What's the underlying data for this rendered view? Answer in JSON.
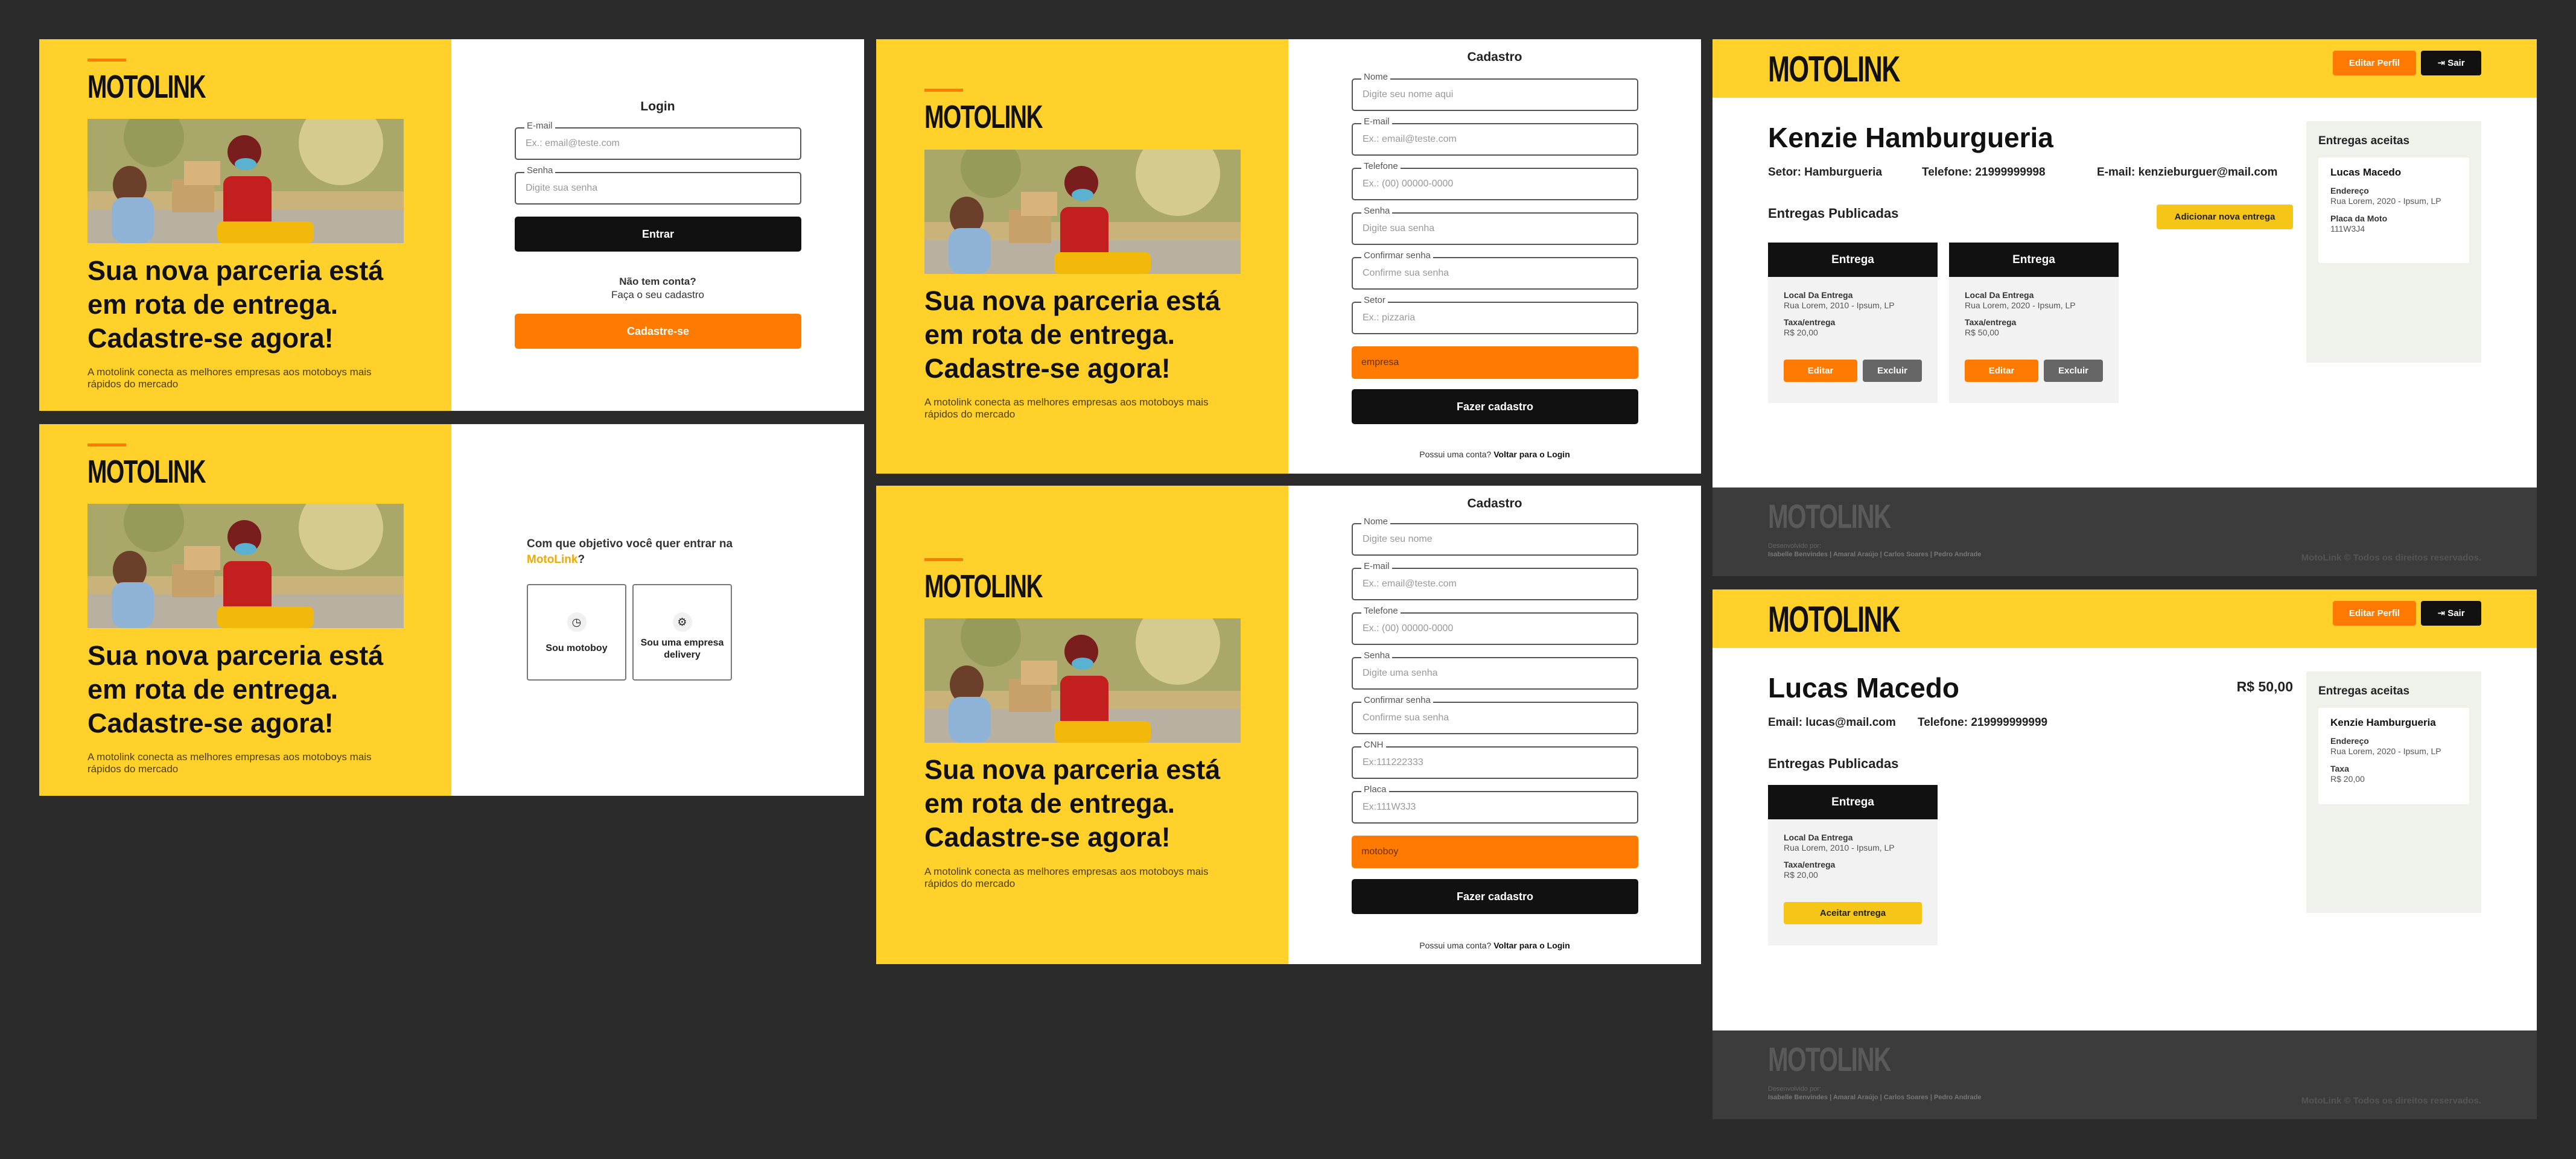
{
  "brand": {
    "logo": "MOTOLINK",
    "headline": "Sua nova parceria está em rota de entrega. Cadastre-se agora!",
    "subtext": "A motolink conecta as melhores empresas aos motoboys mais rápidos do mercado",
    "colors": {
      "yellow": "#ffd12a",
      "orange": "#ff7a00",
      "black": "#111111"
    }
  },
  "login": {
    "title": "Login",
    "email_label": "E-mail",
    "email_placeholder": "Ex.: email@teste.com",
    "password_label": "Senha",
    "password_placeholder": "Digite sua senha",
    "submit": "Entrar",
    "no_account": "Não tem conta?",
    "register_hint": "Faça o seu cadastro",
    "register_button": "Cadastre-se"
  },
  "choose": {
    "question_a": "Com que objetivo você quer entrar na ",
    "question_brand": "MotoLink",
    "question_end": "?",
    "opt_motoboy": "Sou motoboy",
    "opt_company": "Sou uma empresa delivery",
    "icon_motoboy": "motoboy-icon",
    "icon_company": "company-icon"
  },
  "register_company": {
    "title": "Cadastro",
    "fields": [
      {
        "label": "Nome",
        "placeholder": "Digite seu nome aqui"
      },
      {
        "label": "E-mail",
        "placeholder": "Ex.: email@teste.com"
      },
      {
        "label": "Telefone",
        "placeholder": "Ex.: (00) 00000-0000"
      },
      {
        "label": "Senha",
        "placeholder": "Digite sua senha"
      },
      {
        "label": "Confirmar senha",
        "placeholder": "Confirme sua senha"
      },
      {
        "label": "Setor",
        "placeholder": "Ex.: pizzaria"
      }
    ],
    "type_value": "empresa",
    "submit": "Fazer cadastro",
    "footer_q": "Possui uma conta?",
    "footer_link": "Voltar para o Login"
  },
  "register_motoboy": {
    "title": "Cadastro",
    "fields": [
      {
        "label": "Nome",
        "placeholder": "Digite seu nome"
      },
      {
        "label": "E-mail",
        "placeholder": "Ex.: email@teste.com"
      },
      {
        "label": "Telefone",
        "placeholder": "Ex.: (00) 00000-0000"
      },
      {
        "label": "Senha",
        "placeholder": "Digite uma senha"
      },
      {
        "label": "Confirmar senha",
        "placeholder": "Confirme sua senha"
      },
      {
        "label": "CNH",
        "placeholder": "Ex:111222333"
      },
      {
        "label": "Placa",
        "placeholder": "Ex:111W3J3"
      }
    ],
    "type_value": "motoboy",
    "submit": "Fazer cadastro",
    "footer_q": "Possui uma conta?",
    "footer_link": "Voltar para o Login"
  },
  "dash_header": {
    "edit": "Editar Perfil",
    "logout": "Sair"
  },
  "company_dash": {
    "name": "Kenzie Hamburgueria",
    "sector": "Setor: Hamburgueria",
    "phone": "Telefone: 21999999998",
    "email": "E-mail: kenzieburguer@mail.com",
    "section": "Entregas Publicadas",
    "add": "Adicionar nova entrega",
    "cards": [
      {
        "title": "Entrega",
        "k1": "Local Da Entrega",
        "v1": "Rua Lorem, 2010 - Ipsum, LP",
        "k2": "Taxa/entrega",
        "v2": "R$ 20,00",
        "edit": "Editar",
        "del": "Excluir"
      },
      {
        "title": "Entrega",
        "k1": "Local Da Entrega",
        "v1": "Rua Lorem, 2020 - Ipsum, LP",
        "k2": "Taxa/entrega",
        "v2": "R$ 50,00",
        "edit": "Editar",
        "del": "Excluir"
      }
    ],
    "aside_title": "Entregas aceitas",
    "aside": {
      "name": "Lucas Macedo",
      "k1": "Endereço",
      "v1": "Rua Lorem, 2020 - Ipsum, LP",
      "k2": "Placa da Moto",
      "v2": "111W3J4"
    }
  },
  "motoboy_dash": {
    "name": "Lucas Macedo",
    "total": "R$ 50,00",
    "email": "Email: lucas@mail.com",
    "phone": "Telefone: 219999999999",
    "section": "Entregas Publicadas",
    "card": {
      "title": "Entrega",
      "k1": "Local Da Entrega",
      "v1": "Rua Lorem, 2010 - Ipsum, LP",
      "k2": "Taxa/entrega",
      "v2": "R$ 20,00",
      "accept": "Aceitar entrega"
    },
    "aside_title": "Entregas aceitas",
    "aside": {
      "name": "Kenzie Hamburgueria",
      "k1": "Endereço",
      "v1": "Rua Lorem, 2020 - Ipsum, LP",
      "k2": "Taxa",
      "v2": "R$ 20,00"
    }
  },
  "footer": {
    "dev_label": "Desenvolvido por:",
    "devs": "Isabelle Benvindes | Amaral Araújo | Carlos Soares | Pedro Andrade",
    "copyright": "MotoLink © Todos os direitos reservados."
  }
}
